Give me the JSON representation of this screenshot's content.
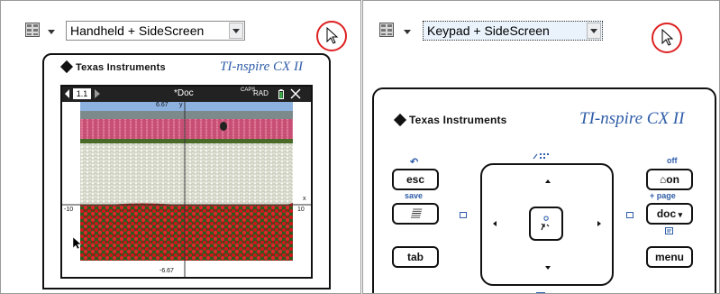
{
  "left_panel": {
    "layout_select": {
      "value": "Handheld + SideScreen"
    },
    "handheld": {
      "brand": "Texas Instruments",
      "model": "TI-nspire CX II",
      "screen": {
        "tab": "1.1",
        "doc_title": "*Doc",
        "status": "RAD",
        "status_small": "CAPS",
        "axis_top": "6.67",
        "axis_top_label": "y",
        "x_min": "-10",
        "x_max": "10",
        "x_label": "x",
        "axis_bottom": "-6.67"
      }
    }
  },
  "right_panel": {
    "layout_select": {
      "value": "Keypad + SideScreen"
    },
    "keypad": {
      "brand": "Texas Instruments",
      "model": "TI-nspire CX II",
      "keys": {
        "esc": "esc",
        "scratchpad_glyph": "𝄚",
        "tab": "tab",
        "on": "on",
        "doc": "doc",
        "menu": "menu"
      },
      "labels": {
        "undo": "↶",
        "save": "save",
        "off": "off",
        "add_page": "+ page"
      }
    }
  },
  "colors": {
    "ti_blue": "#2f5da8",
    "cursor_ring": "#d22222"
  }
}
